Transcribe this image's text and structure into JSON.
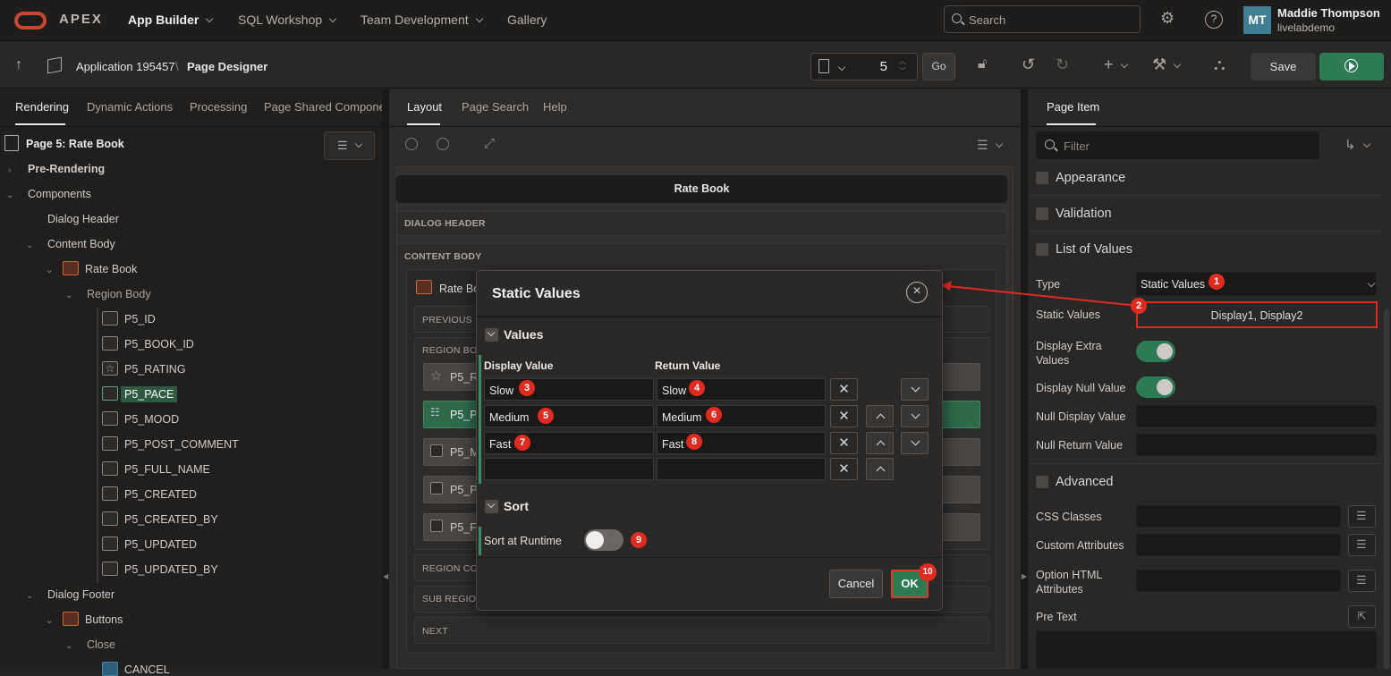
{
  "topbar": {
    "brand": "APEX",
    "nav": [
      "App Builder",
      "SQL Workshop",
      "Team Development",
      "Gallery"
    ],
    "search_placeholder": "Search",
    "user_initials": "MT",
    "user_name": "Maddie Thompson",
    "user_org": "livelabdemo"
  },
  "toolbar": {
    "app": "Application 195457",
    "sep": "\\",
    "page_designer": "Page Designer",
    "page_number": "5",
    "go": "Go",
    "save": "Save"
  },
  "left": {
    "tabs": [
      "Rendering",
      "Dynamic Actions",
      "Processing",
      "Page Shared Componen"
    ],
    "page_title": "Page 5: Rate Book",
    "tree": {
      "pre_rendering": "Pre-Rendering",
      "components": "Components",
      "dialog_header": "Dialog Header",
      "content_body": "Content Body",
      "rate_book": "Rate Book",
      "region_body": "Region Body",
      "items": [
        "P5_ID",
        "P5_BOOK_ID",
        "P5_RATING",
        "P5_PACE",
        "P5_MOOD",
        "P5_POST_COMMENT",
        "P5_FULL_NAME",
        "P5_CREATED",
        "P5_CREATED_BY",
        "P5_UPDATED",
        "P5_UPDATED_BY"
      ],
      "dialog_footer": "Dialog Footer",
      "buttons": "Buttons",
      "close": "Close",
      "cancel": "CANCEL"
    }
  },
  "middle": {
    "tabs": [
      "Layout",
      "Page Search",
      "Help"
    ],
    "rate_book": "Rate Book",
    "dialog_header": "DIALOG HEADER",
    "content_body": "CONTENT BODY",
    "region_title": "Rate Bo",
    "previous": "PREVIOUS",
    "region_body": "REGION BODY",
    "items_cut": [
      "P5_R",
      "P5_PA",
      "P5_M",
      "P5_P",
      "P5_F"
    ],
    "region_content": "REGION CON",
    "sub_regions": "SUB REGIONS",
    "next": "NEXT"
  },
  "right": {
    "tab": "Page Item",
    "filter_placeholder": "Filter",
    "sections": {
      "appearance": "Appearance",
      "validation": "Validation",
      "lov": "List of Values",
      "advanced": "Advanced"
    },
    "type_label": "Type",
    "type_value": "Static Values",
    "static_values_label": "Static Values",
    "static_values_value": "Display1, Display2",
    "display_extra_label": "Display Extra Values",
    "display_null_label": "Display Null Value",
    "null_display_label": "Null Display Value",
    "null_return_label": "Null Return Value",
    "css_classes_label": "CSS Classes",
    "custom_attrs_label": "Custom Attributes",
    "option_html_label": "Option HTML Attributes",
    "pre_text_label": "Pre Text"
  },
  "dialog": {
    "title": "Static Values",
    "values_heading": "Values",
    "col_display": "Display Value",
    "col_return": "Return Value",
    "rows": [
      {
        "display": "Slow",
        "return": "Slow"
      },
      {
        "display": "Medium",
        "return": "Medium"
      },
      {
        "display": "Fast",
        "return": "Fast"
      },
      {
        "display": "",
        "return": ""
      }
    ],
    "sort_heading": "Sort",
    "sort_label": "Sort at Runtime",
    "cancel": "Cancel",
    "ok": "OK"
  },
  "badges": [
    "1",
    "2",
    "3",
    "4",
    "5",
    "6",
    "7",
    "8",
    "9",
    "10"
  ],
  "colors": {
    "accent_green": "#2e7a55",
    "annotation_red": "#e02b20",
    "oracle_red": "#c74634"
  }
}
